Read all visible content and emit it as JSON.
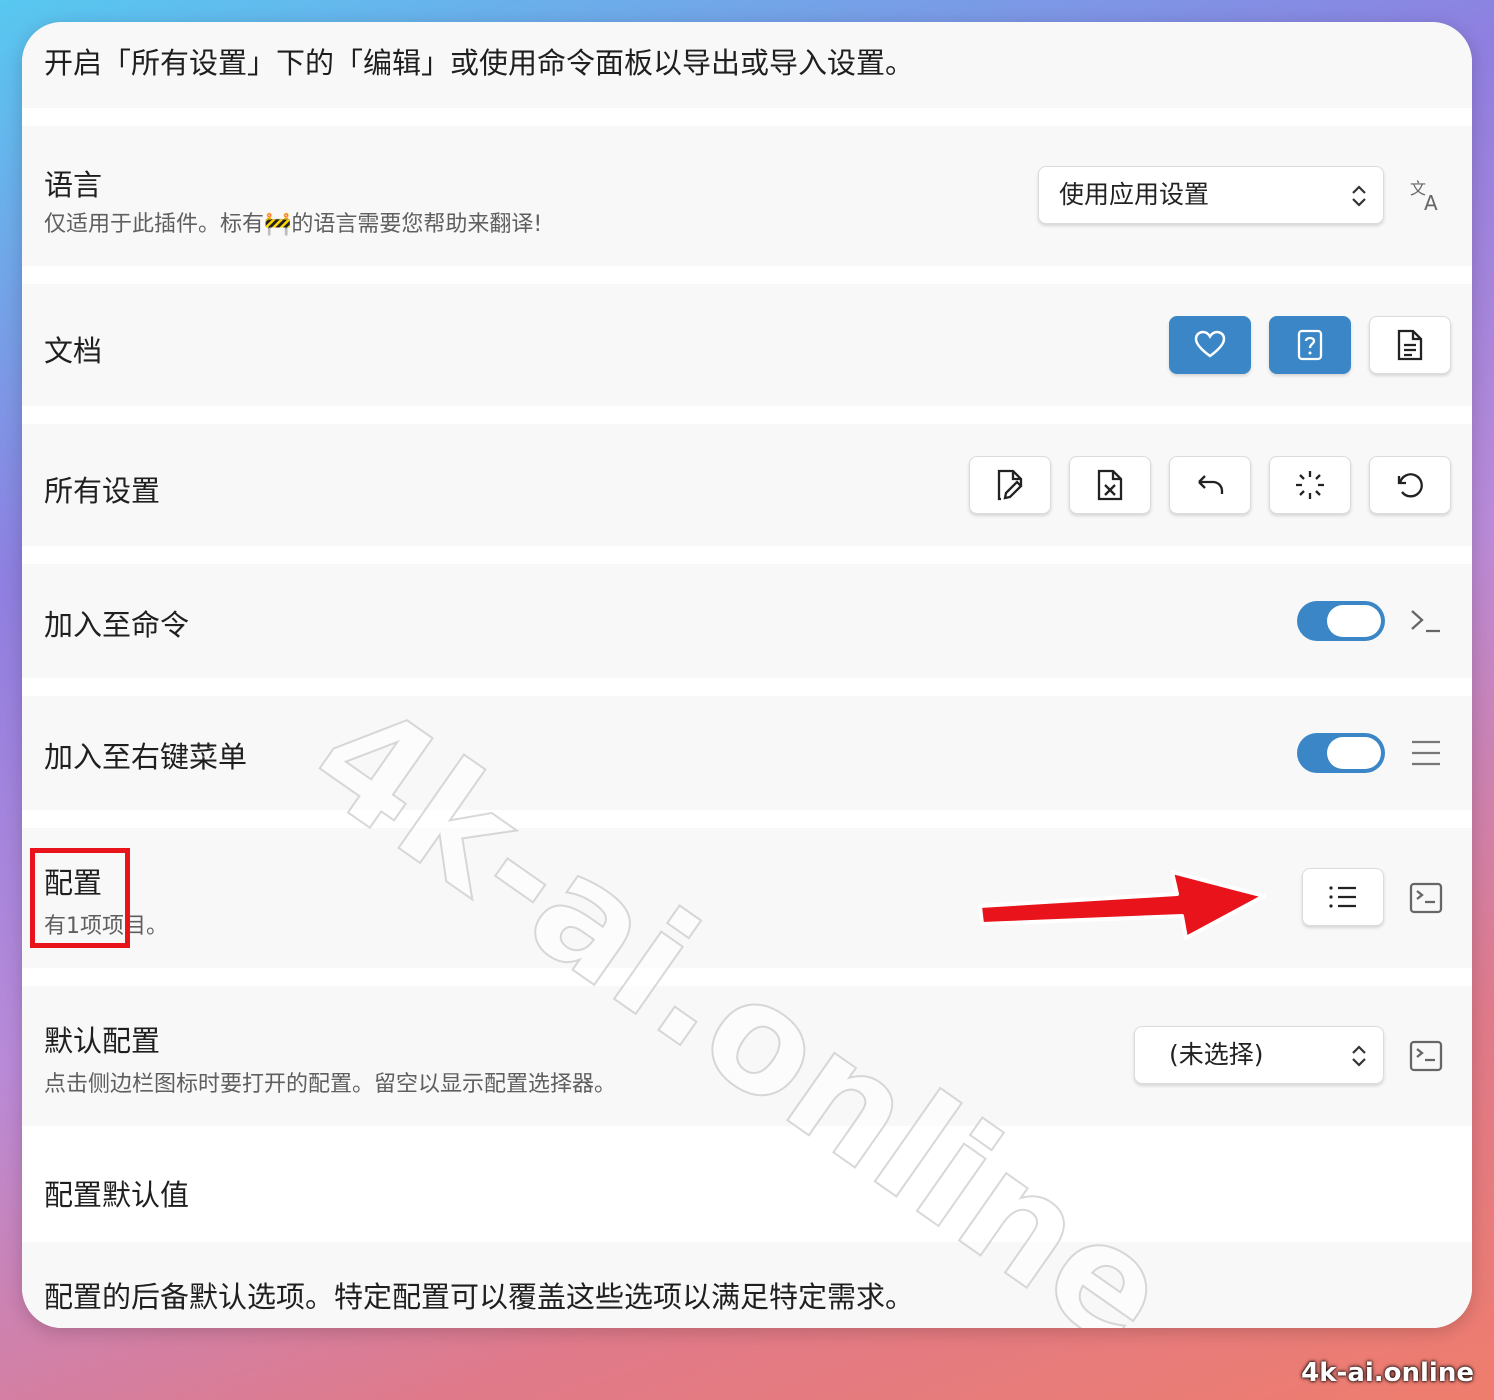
{
  "intro_text": "开启「所有设置」下的「编辑」或使用命令面板以导出或导入设置。",
  "language": {
    "title": "语言",
    "desc": "仅适用于此插件。标有🚧的语言需要您帮助来翻译!",
    "select_value": "使用应用设置",
    "icon": "translate-icon"
  },
  "docs": {
    "title": "文档",
    "buttons": [
      "heart-icon",
      "help-file-icon",
      "document-icon"
    ]
  },
  "all_settings": {
    "title": "所有设置",
    "buttons": [
      "edit-file-icon",
      "delete-file-icon",
      "undo-icon",
      "loader-icon",
      "reset-icon"
    ]
  },
  "add_to_commands": {
    "title": "加入至命令",
    "enabled": true,
    "icon": "terminal-icon"
  },
  "add_to_context_menu": {
    "title": "加入至右键菜单",
    "enabled": true,
    "icon": "menu-icon"
  },
  "profiles": {
    "title": "配置",
    "desc": "有1项项目。",
    "button_icon": "list-icon",
    "icon": "command-icon"
  },
  "default_profile": {
    "title": "默认配置",
    "desc": "点击侧边栏图标时要打开的配置。留空以显示配置选择器。",
    "select_value": "(未选择)",
    "icon": "command-icon"
  },
  "profile_defaults": {
    "title": "配置默认值",
    "desc": "配置的后备默认选项。特定配置可以覆盖这些选项以满足特定需求。"
  },
  "watermark": "4k-ai.online",
  "corner_watermark": "4k-ai.online",
  "colors": {
    "accent": "#3a86c7",
    "annotation": "#e8131b"
  }
}
